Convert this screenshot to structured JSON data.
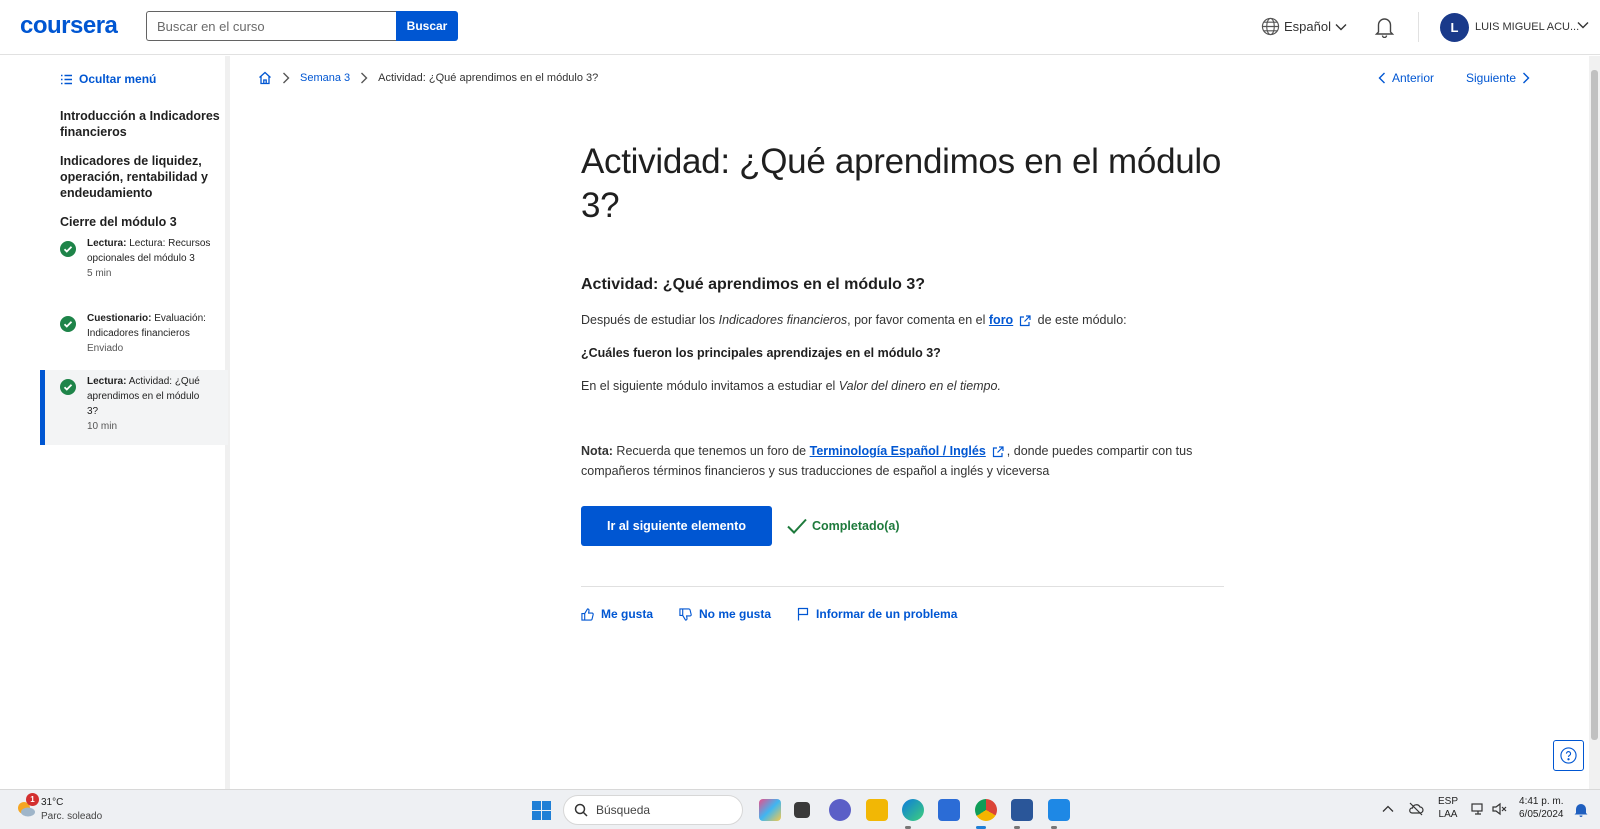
{
  "header": {
    "logo": "coursera",
    "search_placeholder": "Buscar en el curso",
    "search_button": "Buscar",
    "language": "Español",
    "avatar_initial": "L",
    "username": "LUIS MIGUEL ACU..."
  },
  "sidebar": {
    "hide_menu": "Ocultar menú",
    "modules": [
      {
        "title": "Introducción a Indicadores financieros"
      },
      {
        "title": "Indicadores de liquidez, operación, rentabilidad y endeudamiento"
      },
      {
        "title": "Cierre del módulo 3"
      }
    ],
    "items": [
      {
        "type": "Lectura:",
        "title": "Lectura: Recursos opcionales del módulo 3",
        "meta": "5 min",
        "completed": true,
        "active": false
      },
      {
        "type": "Cuestionario:",
        "title": "Evaluación: Indicadores financieros",
        "meta": "Enviado",
        "completed": true,
        "active": false
      },
      {
        "type": "Lectura:",
        "title": "Actividad: ¿Qué aprendimos en el módulo 3?",
        "meta": "10 min",
        "completed": true,
        "active": true
      }
    ]
  },
  "breadcrumb": {
    "week": "Semana 3",
    "current": "Actividad: ¿Qué aprendimos en el módulo 3?"
  },
  "nav": {
    "prev": "Anterior",
    "next": "Siguiente"
  },
  "main": {
    "title": "Actividad: ¿Qué aprendimos en el módulo 3?",
    "subtitle": "Actividad: ¿Qué aprendimos en el módulo 3?",
    "p1_a": "Después de estudiar los ",
    "p1_em": "Indicadores financieros",
    "p1_b": ", por favor comenta en el ",
    "p1_link": "foro",
    "p1_c": " de este módulo:",
    "question": "¿Cuáles fueron los principales aprendizajes en el módulo 3?",
    "p3_a": "En el siguiente módulo invitamos a estudiar el ",
    "p3_em": "Valor del dinero en el tiempo.",
    "note_label": "Nota:",
    "note_a": " Recuerda que tenemos un foro de ",
    "note_link": "Terminología Español / Inglés",
    "note_b": ", donde puedes compartir con tus compañeros términos financieros y sus traducciones de español a inglés y viceversa",
    "next_button": "Ir al siguiente elemento",
    "completed": "Completado(a)",
    "like": "Me gusta",
    "dislike": "No me gusta",
    "report": "Informar de un problema"
  },
  "taskbar": {
    "weather_badge": "1",
    "temperature": "31°C",
    "condition": "Parc. soleado",
    "search": "Búsqueda",
    "lang_1": "ESP",
    "lang_2": "LAA",
    "time": "4:41 p. m.",
    "date": "6/05/2024"
  },
  "colors": {
    "accent": "#0056d2",
    "success": "#1e8449"
  }
}
